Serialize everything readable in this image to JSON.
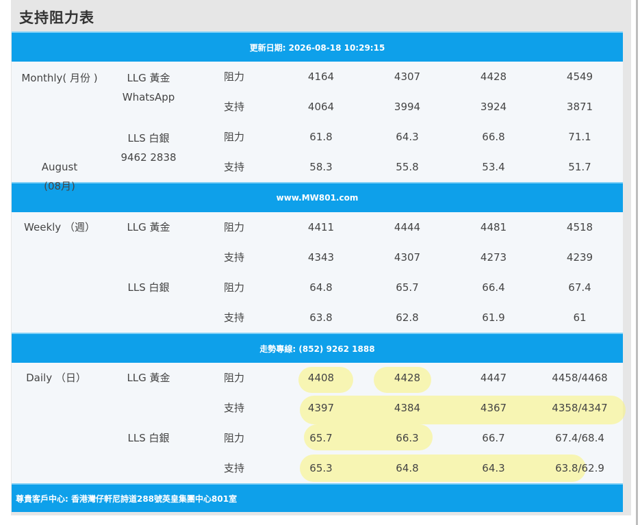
{
  "title": "支持阻力表",
  "updated": "更新日期: 2026-08-18 10:29:15",
  "website": "www.MW801.com",
  "hotline": "走勢專線: (852) 9262 1888",
  "address": "尊貴客戶中心: 香港灣仔軒尼詩道288號英皇集團中心801室",
  "monthly": {
    "period_line1": "Monthly( 月份 )",
    "period_line2": "August",
    "period_line3": "(08月)",
    "gold_label": "LLG 黃金",
    "whatsapp": "WhatsApp",
    "silver_label": "LLS 白銀",
    "phone": "9462 2838",
    "rows": [
      {
        "type": "阻力",
        "v": [
          "4164",
          "4307",
          "4428",
          "4549"
        ]
      },
      {
        "type": "支持",
        "v": [
          "4064",
          "3994",
          "3924",
          "3871"
        ]
      },
      {
        "type": "阻力",
        "v": [
          "61.8",
          "64.3",
          "66.8",
          "71.1"
        ]
      },
      {
        "type": "支持",
        "v": [
          "58.3",
          "55.8",
          "53.4",
          "51.7"
        ]
      }
    ]
  },
  "weekly": {
    "period": "Weekly （週）",
    "gold_label": "LLG 黃金",
    "silver_label": "LLS 白銀",
    "rows": [
      {
        "type": "阻力",
        "v": [
          "4411",
          "4444",
          "4481",
          "4518"
        ]
      },
      {
        "type": "支持",
        "v": [
          "4343",
          "4307",
          "4273",
          "4239"
        ]
      },
      {
        "type": "阻力",
        "v": [
          "64.8",
          "65.7",
          "66.4",
          "67.4"
        ]
      },
      {
        "type": "支持",
        "v": [
          "63.8",
          "62.8",
          "61.9",
          "61"
        ]
      }
    ]
  },
  "daily": {
    "period": "Daily （日）",
    "gold_label": "LLG 黃金",
    "silver_label": "LLS 白銀",
    "rows": [
      {
        "type": "阻力",
        "v": [
          "4408",
          "4428",
          "4447",
          "4458/4468"
        ]
      },
      {
        "type": "支持",
        "v": [
          "4397",
          "4384",
          "4367",
          "4358/4347"
        ]
      },
      {
        "type": "阻力",
        "v": [
          "65.7",
          "66.3",
          "66.7",
          "67.4/68.4"
        ]
      },
      {
        "type": "支持",
        "v": [
          "65.3",
          "64.8",
          "64.3",
          "63.8/62.9"
        ]
      }
    ]
  },
  "highlight_color": "#faf478"
}
